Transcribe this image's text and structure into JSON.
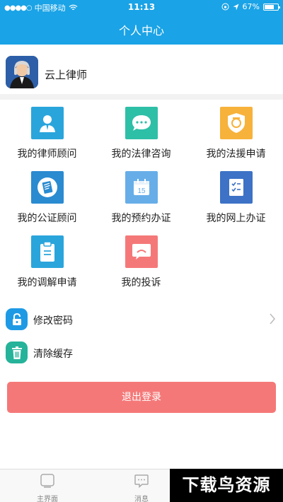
{
  "status_bar": {
    "signal": "●●●●○",
    "carrier": "中国移动",
    "time": "11:13",
    "battery": "67%"
  },
  "nav": {
    "title": "个人中心"
  },
  "profile": {
    "name": "云上律师"
  },
  "grid": [
    {
      "label": "我的律师顾问",
      "icon": "person-icon",
      "color": "#2aa5dc"
    },
    {
      "label": "我的法律咨询",
      "icon": "chat-bubble-icon",
      "color": "#2ebfa7"
    },
    {
      "label": "我的法援申请",
      "icon": "badge-icon",
      "color": "#f7b23b"
    },
    {
      "label": "我的公证顾问",
      "icon": "notary-icon",
      "color": "#2a8bd1"
    },
    {
      "label": "我的预约办证",
      "icon": "calendar-icon",
      "color": "#67aee8",
      "calendar_day": "15"
    },
    {
      "label": "我的网上办证",
      "icon": "checklist-icon",
      "color": "#3d72c6"
    },
    {
      "label": "我的调解申请",
      "icon": "clipboard-icon",
      "color": "#2aa5dc"
    },
    {
      "label": "我的投诉",
      "icon": "sad-face-icon",
      "color": "#f57878"
    }
  ],
  "settings": [
    {
      "label": "修改密码",
      "icon": "lock-icon",
      "color": "#1e9ae5"
    },
    {
      "label": "清除缓存",
      "icon": "trash-icon",
      "color": "#25b39a"
    }
  ],
  "logout": {
    "label": "退出登录",
    "color": "#f57878"
  },
  "tabbar": [
    {
      "label": "主界面",
      "icon": "home-screen-icon"
    },
    {
      "label": "消息",
      "icon": "message-icon"
    }
  ],
  "watermark": {
    "text": "下载鸟资源"
  }
}
